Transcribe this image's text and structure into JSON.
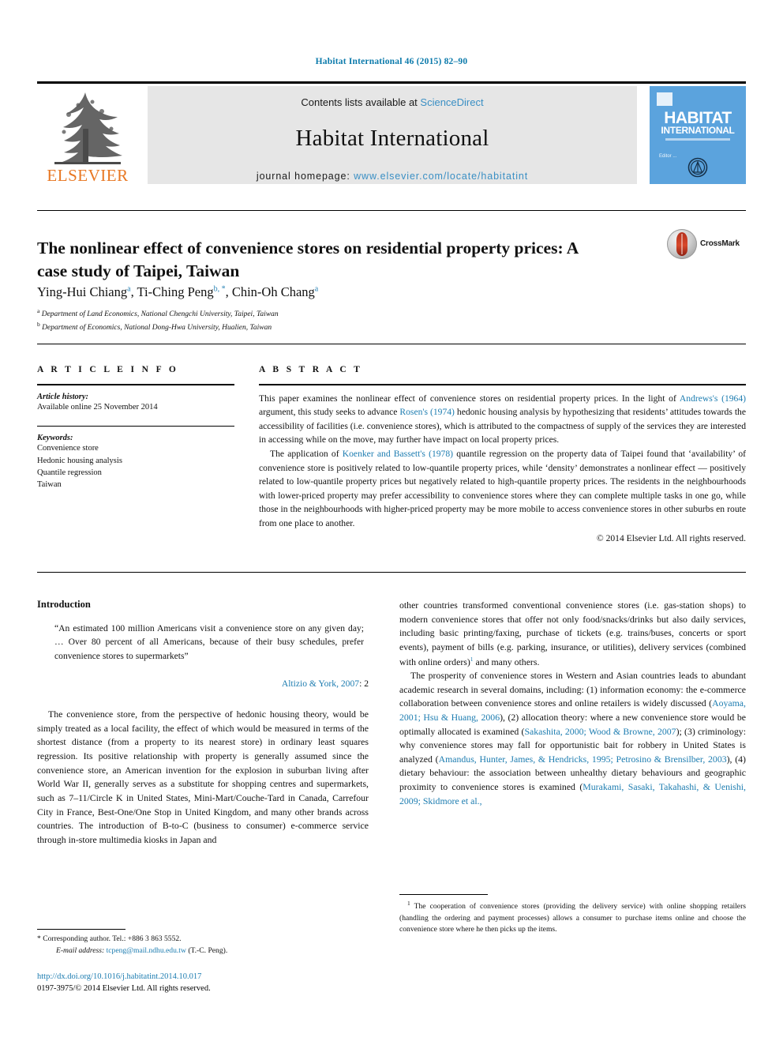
{
  "running_head": "Habitat International 46 (2015) 82–90",
  "masthead": {
    "publisher": "ELSEVIER",
    "contents_prefix": "Contents lists available at ",
    "contents_link": "ScienceDirect",
    "journal_name": "Habitat International",
    "homepage_prefix": "journal homepage: ",
    "homepage_link": "www.elsevier.com/locate/habitatint",
    "cover_title_line1": "HABITAT",
    "cover_title_line2": "INTERNATIONAL",
    "cover_subtitle": "Editor ...",
    "link_color": "#3a8fc4",
    "cover_bg": "#5ba3dd",
    "elsevier_orange": "#E87722"
  },
  "crossmark": {
    "label": "CrossMark"
  },
  "article": {
    "title": "The nonlinear effect of convenience stores on residential property prices: A case study of Taipei, Taiwan",
    "authors_parts": [
      {
        "name": "Ying-Hui Chiang",
        "sup": "a",
        "sep": ", "
      },
      {
        "name": "Ti-Ching Peng",
        "sup": "b, *",
        "sep": ", "
      },
      {
        "name": "Chin-Oh Chang",
        "sup": "a",
        "sep": ""
      }
    ],
    "affiliations": [
      {
        "mark": "a",
        "text": "Department of Land Economics, National Chengchi University, Taipei, Taiwan"
      },
      {
        "mark": "b",
        "text": "Department of Economics, National Dong-Hwa University, Hualien, Taiwan"
      }
    ]
  },
  "article_info": {
    "heading": "A R T I C L E   I N F O",
    "history_label": "Article history:",
    "history_value": "Available online 25 November 2014",
    "keywords_label": "Keywords:",
    "keywords": [
      "Convenience store",
      "Hedonic housing analysis",
      "Quantile regression",
      "Taiwan"
    ]
  },
  "abstract": {
    "heading": "A B S T R A C T",
    "paragraph1": "This paper examines the nonlinear effect of convenience stores on residential property prices. In the light of Andrews's (1964) argument, this study seeks to advance Rosen's (1974) hedonic housing analysis by hypothesizing that residents' attitudes towards the accessibility of facilities (i.e. convenience stores), which is attributed to the compactness of supply of the services they are interested in accessing while on the move, may further have impact on local property prices.",
    "paragraph2": "The application of Koenker and Bassett's (1978) quantile regression on the property data of Taipei found that 'availability' of convenience store is positively related to low-quantile property prices, while 'density' demonstrates a nonlinear effect — positively related to low-quantile property prices but negatively related to high-quantile property prices. The residents in the neighbourhoods with lower-priced property may prefer accessibility to convenience stores where they can complete multiple tasks in one go, while those in the neighbourhoods with higher-priced property may be more mobile to access convenience stores in other suburbs en route from one place to another.",
    "rights": "© 2014 Elsevier Ltd. All rights reserved."
  },
  "introduction": {
    "heading": "Introduction",
    "epigraph": "“An estimated 100 million Americans visit a convenience store on any given day; … Over 80 percent of all Americans, because of their busy schedules, prefer convenience stores to supermarkets”",
    "epigraph_source": "Altizio & York, 2007",
    "epigraph_page": ": 2",
    "left_paragraph": "The convenience store, from the perspective of hedonic housing theory, would be simply treated as a local facility, the effect of which would be measured in terms of the shortest distance (from a property to its nearest store) in ordinary least squares regression. Its positive relationship with property is generally assumed since the convenience store, an American invention for the explosion in suburban living after World War II, generally serves as a substitute for shopping centres and supermarkets, such as 7–11/Circle K in United States, Mini-Mart/Couche-Tard in Canada, Carrefour City in France, Best-One/One Stop in United Kingdom, and many other brands across countries. The introduction of B-to-C (business to consumer) e-commerce service through in-store multimedia kiosks in Japan and",
    "right_paragraph_1": "other countries transformed conventional convenience stores (i.e. gas-station shops) to modern convenience stores that offer not only food/snacks/drinks but also daily services, including basic printing/faxing, purchase of tickets (e.g. trains/buses, concerts or sport events), payment of bills (e.g. parking, insurance, or utilities), delivery services (combined with online orders)",
    "right_paragraph_1_tail": " and many others.",
    "right_paragraph_2": "The prosperity of convenience stores in Western and Asian countries leads to abundant academic research in several domains, including: (1) information economy: the e-commerce collaboration between convenience stores and online retailers is widely discussed (",
    "right_citations": {
      "c1": "Aoyama, 2001; Hsu & Huang, 2006",
      "c2": "Sakashita, 2000; Wood & Browne, 2007",
      "c3": "Amandus, Hunter, James, & Hendricks, 1995; Petrosino & Brensilber, 2003",
      "c4": "Murakami, Sasaki, Takahashi, & Uenishi, 2009; Skidmore et al.,"
    },
    "right_seg_2": "), (2) allocation theory: where a new convenience store would be optimally allocated is examined (",
    "right_seg_3": "); (3) criminology: why convenience stores may fall for opportunistic bait for robbery in United States is analyzed (",
    "right_seg_4": "), (4) dietary behaviour: the association between unhealthy dietary behaviours and geographic proximity to convenience stores is examined ("
  },
  "footnotes": {
    "corresponding_mark": "*",
    "corresponding": "Corresponding author. Tel.: +886 3 863 5552.",
    "email_label": "E-mail address:",
    "email": "tcpeng@mail.ndhu.edu.tw",
    "email_owner": "(T.-C. Peng).",
    "right_mark": "1",
    "right_note": "The cooperation of convenience stores (providing the delivery service) with online shopping retailers (handling the ordering and payment processes) allows a consumer to purchase items online and choose the convenience store where he then picks up the items."
  },
  "imprint": {
    "doi": "http://dx.doi.org/10.1016/j.habitatint.2014.10.017",
    "issn_line": "0197-3975/© 2014 Elsevier Ltd. All rights reserved."
  }
}
